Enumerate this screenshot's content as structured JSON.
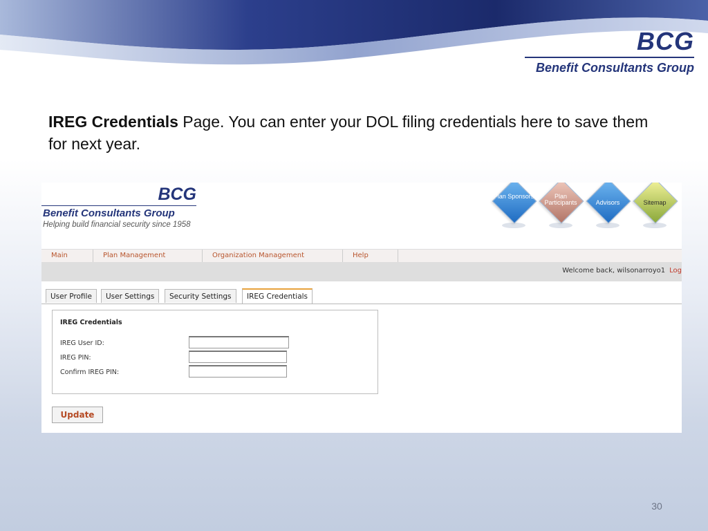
{
  "slide": {
    "logo": {
      "abbr": "BCG",
      "name": "Benefit Consultants Group"
    },
    "caption": {
      "bold": "IREG Credentials",
      "rest": " Page.  You can enter your DOL filing credentials here to save them for next year."
    },
    "page_number": "30"
  },
  "app": {
    "logo": {
      "abbr": "BCG",
      "name": "Benefit Consultants Group",
      "tagline": "Helping build financial security since 1958"
    },
    "quick_links": [
      {
        "label": "Plan Sponsors",
        "icon": "plan-sponsors-icon",
        "color": "#2f7fd1"
      },
      {
        "label": "Plan Participants",
        "icon": "plan-participants-icon",
        "color": "#d39a8c"
      },
      {
        "label": "Advisors",
        "icon": "advisors-icon",
        "color": "#2f7fd1"
      },
      {
        "label": "Sitemap",
        "icon": "sitemap-icon",
        "color": "#c8d43a"
      }
    ],
    "nav": [
      "Main",
      "Plan Management",
      "Organization Management",
      "Help"
    ],
    "welcome": {
      "text": "Welcome back, wilsonarroyo1",
      "logout": "Log"
    },
    "tabs": [
      "User Profile",
      "User Settings",
      "Security Settings",
      "IREG Credentials"
    ],
    "active_tab": "IREG Credentials",
    "panel": {
      "title": "IREG Credentials",
      "fields": [
        {
          "label": "IREG User ID:",
          "value": ""
        },
        {
          "label": "IREG PIN:",
          "value": ""
        },
        {
          "label": "Confirm IREG PIN:",
          "value": ""
        }
      ]
    },
    "update_button": "Update"
  },
  "colors": {
    "brand": "#24357a",
    "nav_link": "#b8542c",
    "tab_accent": "#e8a23b",
    "button_text": "#b54a24"
  }
}
